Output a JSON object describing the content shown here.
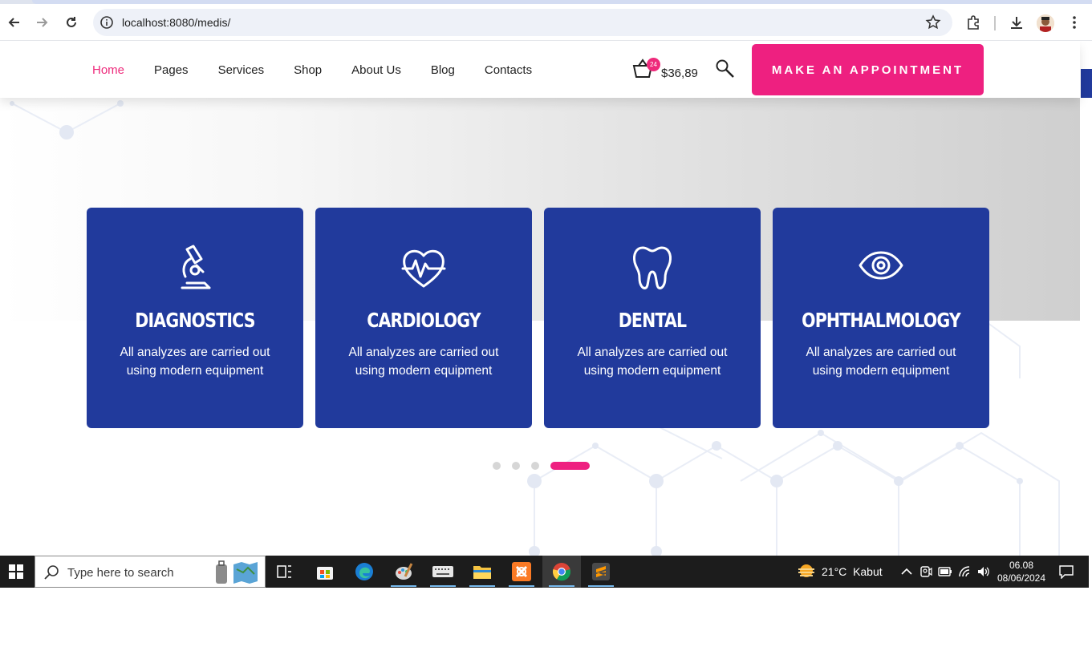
{
  "browser": {
    "url": "localhost:8080/medis/"
  },
  "header": {
    "menu": [
      {
        "label": "Home",
        "active": true
      },
      {
        "label": "Pages",
        "active": false
      },
      {
        "label": "Services",
        "active": false
      },
      {
        "label": "Shop",
        "active": false
      },
      {
        "label": "About Us",
        "active": false
      },
      {
        "label": "Blog",
        "active": false
      },
      {
        "label": "Contacts",
        "active": false
      }
    ],
    "cart_count": "24",
    "cart_total": "$36,89",
    "appointment_label": "MAKE AN APPOINTMENT"
  },
  "cards": [
    {
      "title": "DIAGNOSTICS",
      "desc_line1": "All analyzes are carried out",
      "desc_line2": "using modern equipment",
      "icon": "microscope-icon"
    },
    {
      "title": "CARDIOLOGY",
      "desc_line1": "All analyzes are carried out",
      "desc_line2": "using modern equipment",
      "icon": "heartbeat-icon"
    },
    {
      "title": "DENTAL",
      "desc_line1": "All analyzes are carried out",
      "desc_line2": "using modern equipment",
      "icon": "tooth-icon"
    },
    {
      "title": "OPHTHALMOLOGY",
      "desc_line1": "All analyzes are carried out",
      "desc_line2": "using modern equipment",
      "icon": "eye-icon"
    }
  ],
  "slider": {
    "total_dots": 4,
    "active_index": 3
  },
  "taskbar": {
    "search_placeholder": "Type here to search",
    "weather_temp": "21°C",
    "weather_desc": "Kabut",
    "time": "06.08",
    "date": "08/06/2024"
  },
  "colors": {
    "accent": "#ee2080",
    "card_blue": "#213a9c",
    "active_menu": "#ee2a7b"
  }
}
